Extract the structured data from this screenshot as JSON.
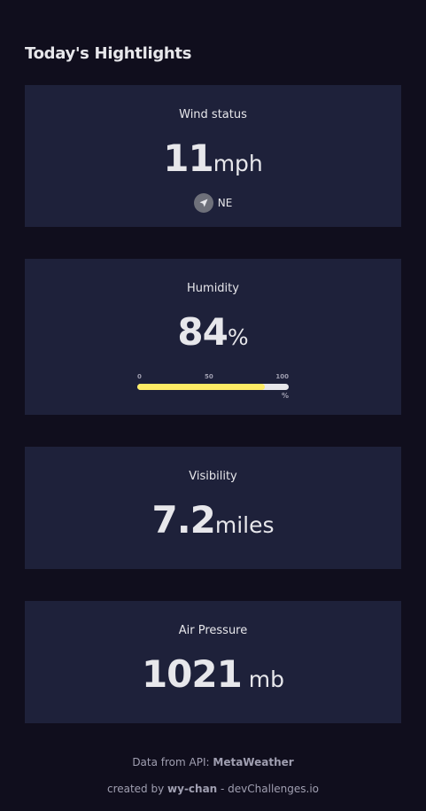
{
  "heading": "Today's Hightlights",
  "wind": {
    "title": "Wind status",
    "value": "11",
    "unit": "mph",
    "direction": "NE",
    "icon": "navigation-arrow-icon"
  },
  "humidity": {
    "title": "Humidity",
    "value": "84",
    "unit": "%",
    "scale_min": "0",
    "scale_mid": "50",
    "scale_max": "100",
    "scale_unit": "%",
    "level_percent": 84,
    "fill_color": "#ffec65"
  },
  "visibility": {
    "title": "Visibility",
    "value": "7.2",
    "unit": "miles"
  },
  "pressure": {
    "title": "Air Pressure",
    "value": "1021",
    "unit": " mb"
  },
  "footer": {
    "api_prefix": "Data from API: ",
    "api_name": "MetaWeather",
    "credit_prefix": "created by ",
    "credit_author": "wy-chan",
    "credit_suffix": " - devChallenges.io"
  },
  "colors": {
    "background": "#100e1d",
    "card": "#1e213a",
    "text": "#e7e7eb",
    "muted": "#a09fb1",
    "accent": "#ffec65"
  }
}
